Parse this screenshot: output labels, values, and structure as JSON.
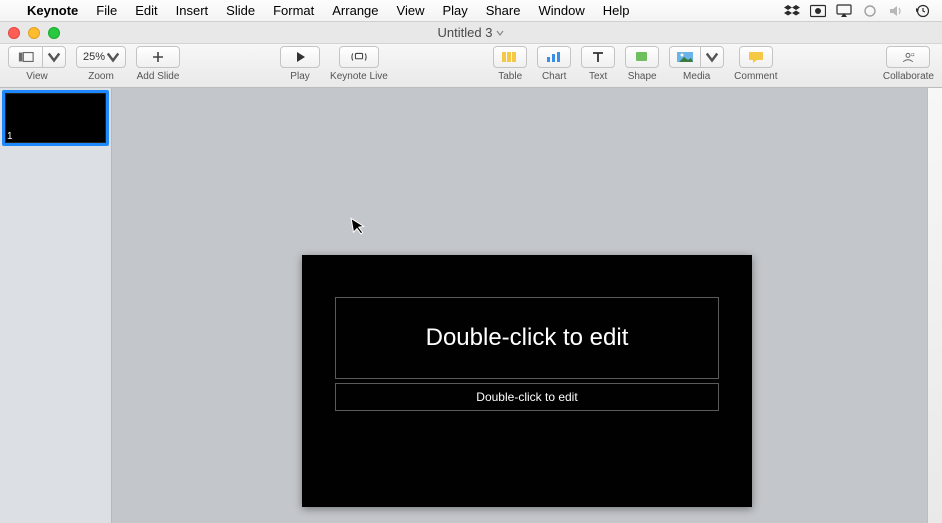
{
  "menubar": {
    "app": "Keynote",
    "items": [
      "File",
      "Edit",
      "Insert",
      "Slide",
      "Format",
      "Arrange",
      "View",
      "Play",
      "Share",
      "Window",
      "Help"
    ]
  },
  "window": {
    "title": "Untitled 3"
  },
  "toolbar": {
    "view": "View",
    "zoom": "Zoom",
    "zoom_value": "25%",
    "add_slide": "Add Slide",
    "play": "Play",
    "keynote_live": "Keynote Live",
    "table": "Table",
    "chart": "Chart",
    "text": "Text",
    "shape": "Shape",
    "media": "Media",
    "comment": "Comment",
    "collaborate": "Collaborate"
  },
  "sidebar": {
    "thumb1_num": "1"
  },
  "slide": {
    "title_placeholder": "Double-click to edit",
    "subtitle_placeholder": "Double-click to edit"
  }
}
